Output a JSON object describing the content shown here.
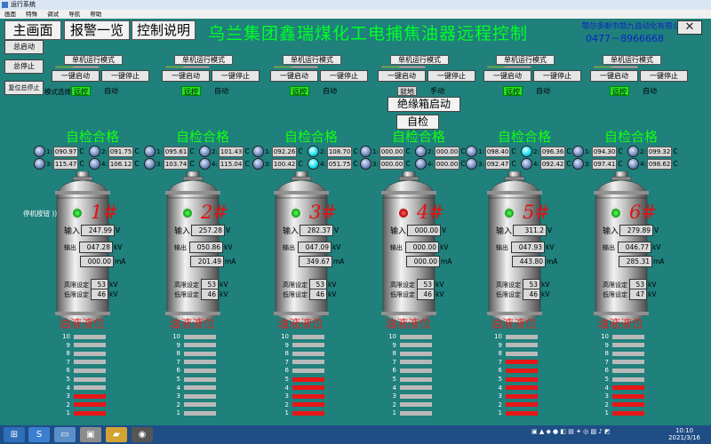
{
  "window_title": "运行系统",
  "menu": [
    "画面",
    "特殊",
    "调试",
    "导航",
    "帮助"
  ],
  "nav": {
    "main": "主画面",
    "alarm": "报警一览",
    "help": "控制说明"
  },
  "title": "乌兰集团鑫瑞煤化工电捕焦油器远程控制",
  "company": "鄂尔多斯市勋九自动化有限公司",
  "phone": "0477－8966668",
  "left_buttons": {
    "start": "总启动",
    "stop": "总停止",
    "reset": "复位总停止"
  },
  "mode_select_label": "模式选择",
  "insulation_start": "绝缘箱启动",
  "self_check_button": "自检",
  "stop_label": "停机按钮",
  "units": {
    "v": "V",
    "kv": "kV",
    "ma": "mA",
    "c": "C"
  },
  "labels": {
    "input": "输入",
    "output": "输出",
    "high": "高限设定",
    "low": "低限设定",
    "check_ok": "自检合格",
    "level": "油液液位"
  },
  "units_data": [
    {
      "mode_title": "单机运行模式",
      "start": "一键启动",
      "stop": "一键停止",
      "tag1": "远控",
      "tag1_state": "on",
      "tag2": "自动",
      "num": "1#",
      "led": "g",
      "temps": [
        "090.97",
        "091.75",
        "115.47",
        "106.12"
      ],
      "temp_cyan": [
        false,
        false,
        false,
        false
      ],
      "input_v": "247.99",
      "out_kv": "047.28",
      "out_ma": "000.00",
      "high": "53",
      "low": "46",
      "level": 3
    },
    {
      "mode_title": "单机运行模式",
      "start": "一键启动",
      "stop": "一键停止",
      "tag1": "远控",
      "tag1_state": "on",
      "tag2": "自动",
      "num": "2#",
      "led": "g",
      "temps": [
        "095.61",
        "101.43",
        "103.74",
        "115.04"
      ],
      "temp_cyan": [
        false,
        false,
        false,
        false
      ],
      "input_v": "257.28",
      "out_kv": "050.86",
      "out_ma": "201.49",
      "high": "53",
      "low": "46",
      "level": 0
    },
    {
      "mode_title": "单机运行模式",
      "start": "一键启动",
      "stop": "一键停止",
      "tag1": "远控",
      "tag1_state": "on",
      "tag2": "自动",
      "num": "3#",
      "led": "g",
      "temps": [
        "092.26",
        "108.70",
        "100.42",
        "051.75"
      ],
      "temp_cyan": [
        false,
        true,
        false,
        true
      ],
      "input_v": "282.37",
      "out_kv": "047.09",
      "out_ma": "349.67",
      "high": "53",
      "low": "46",
      "level": 5
    },
    {
      "mode_title": "单机运行模式",
      "start": "一键启动",
      "stop": "一键停止",
      "tag1": "就地",
      "tag1_state": "off",
      "tag2": "手动",
      "num": "4#",
      "led": "r",
      "temps": [
        "000.00",
        "000.00",
        "000.00",
        "000.00"
      ],
      "temp_cyan": [
        false,
        false,
        false,
        false
      ],
      "input_v": "000.00",
      "out_kv": "000.00",
      "out_ma": "000.00",
      "high": "53",
      "low": "46",
      "level": 0
    },
    {
      "mode_title": "单机运行模式",
      "start": "一键启动",
      "stop": "一键停止",
      "tag1": "远控",
      "tag1_state": "on",
      "tag2": "自动",
      "num": "5#",
      "led": "g",
      "temps": [
        "098.40",
        "096.36",
        "092.47",
        "092.42"
      ],
      "temp_cyan": [
        false,
        true,
        false,
        false
      ],
      "input_v": "311.2",
      "out_kv": "047.93",
      "out_ma": "443.80",
      "high": "53",
      "low": "46",
      "level": 7
    },
    {
      "mode_title": "单机运行模式",
      "start": "一键启动",
      "stop": "一键停止",
      "tag1": "远控",
      "tag1_state": "on",
      "tag2": "自动",
      "num": "6#",
      "led": "g",
      "temps": [
        "094.30",
        "099.32",
        "097.41",
        "098.62"
      ],
      "temp_cyan": [
        false,
        false,
        false,
        false
      ],
      "input_v": "279.89",
      "out_kv": "046.77",
      "out_ma": "285.31",
      "high": "53",
      "low": "47",
      "level": 4
    }
  ],
  "taskbar": {
    "time": "10:10",
    "date": "2021/3/16"
  }
}
